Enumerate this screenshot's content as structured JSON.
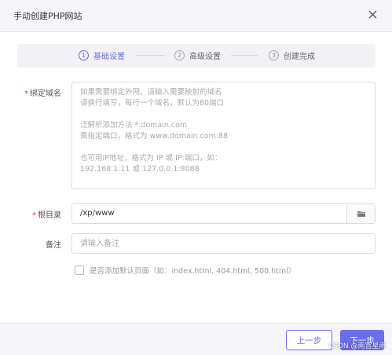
{
  "dialog": {
    "title": "手动创建PHP网站",
    "close_icon": "close-icon"
  },
  "steps": [
    {
      "num": "1",
      "label": "基础设置",
      "active": true
    },
    {
      "num": "2",
      "label": "高级设置",
      "active": false
    },
    {
      "num": "3",
      "label": "创建完成",
      "active": false
    }
  ],
  "form": {
    "domain": {
      "required_mark": "*",
      "label": "绑定域名",
      "placeholder": "如果需要绑定外网，请输入需要映射的域名\n请换行填写，每行一个域名，默认为80端口\n\n泛解析添加方法 *.domain.com\n需指定端口，格式为 www.domain.com:88\n\n也可用IP地址，格式为 IP 或 IP:端口，如：\n192.168.1.11 或 127.0.0.1:8088"
    },
    "root": {
      "required_mark": "*",
      "label": "根目录",
      "value": "/xp/www",
      "button_icon": "folder-icon"
    },
    "remark": {
      "label": "备注",
      "placeholder": "请输入备注"
    },
    "default_page": {
      "label": "是否添加默认页面（如：index.html, 404.html, 500.html）",
      "checked": false
    }
  },
  "footer": {
    "prev_label": "上一步",
    "next_label": "下一步"
  },
  "watermark": "CSDN @南宫星雨",
  "colors": {
    "accent": "#6b6df1",
    "required": "#e53935"
  }
}
